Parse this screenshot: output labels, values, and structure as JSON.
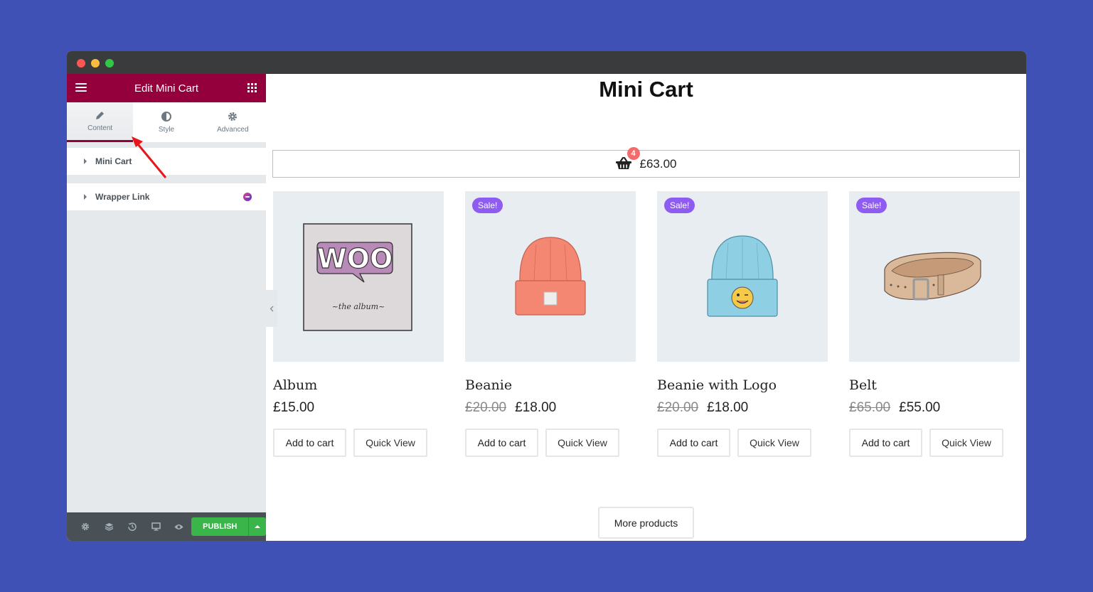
{
  "editor": {
    "header_title": "Edit Mini Cart",
    "tabs": [
      {
        "label": "Content",
        "icon": "pencil-icon",
        "active": true
      },
      {
        "label": "Style",
        "icon": "half-circle-icon",
        "active": false
      },
      {
        "label": "Advanced",
        "icon": "gear-icon",
        "active": false
      }
    ],
    "sections": [
      {
        "label": "Mini Cart"
      },
      {
        "label": "Wrapper Link",
        "badge_icon": "addon-logo-icon"
      }
    ],
    "footer": {
      "icons": [
        "settings-icon",
        "layers-icon",
        "history-icon",
        "responsive-icon",
        "preview-icon"
      ],
      "publish_label": "PUBLISH"
    },
    "colors": {
      "brand": "#93003c",
      "publish": "#39b54a"
    }
  },
  "page": {
    "title": "Mini Cart",
    "mini_cart": {
      "count": "4",
      "total": "£63.00",
      "icon": "basket-icon"
    },
    "products": [
      {
        "name": "Album",
        "price": "£15.00",
        "regular_price": null,
        "sale": false,
        "image": "album-cover"
      },
      {
        "name": "Beanie",
        "price": "£18.00",
        "regular_price": "£20.00",
        "sale": true,
        "image": "orange-beanie"
      },
      {
        "name": "Beanie with Logo",
        "price": "£18.00",
        "regular_price": "£20.00",
        "sale": true,
        "image": "blue-beanie-logo"
      },
      {
        "name": "Belt",
        "price": "£55.00",
        "regular_price": "£65.00",
        "sale": true,
        "image": "leather-belt"
      }
    ],
    "sale_label": "Sale!",
    "add_to_cart_label": "Add to cart",
    "quick_view_label": "Quick View",
    "more_products_label": "More products",
    "colors": {
      "sale_badge": "#8e5cf0",
      "cart_border": "#7fd4e5",
      "count_badge": "#f56b6b"
    }
  }
}
